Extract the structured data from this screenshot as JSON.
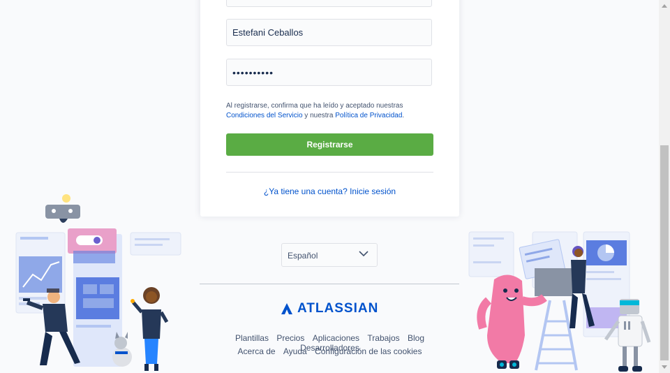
{
  "form": {
    "name_value": "Estefani Ceballos",
    "password_value": "••••••••••",
    "terms_prefix": "Al registrarse, confirma que ha leído y aceptado nuestras",
    "terms_link": "Condiciones del Servicio",
    "terms_middle": " y nuestra ",
    "privacy_link": "Política de Privacidad",
    "terms_suffix": ".",
    "register_label": "Registrarse",
    "login_link": "¿Ya tiene una cuenta? Inicie sesión"
  },
  "language": {
    "selected": "Español"
  },
  "footer": {
    "brand": "ATLASSIAN",
    "links_row1": [
      "Plantillas",
      "Precios",
      "Aplicaciones",
      "Trabajos",
      "Blog",
      "Desarrolladores"
    ],
    "links_row2": [
      "Acerca de",
      "Ayuda",
      "Configuración de las cookies"
    ]
  },
  "colors": {
    "accent": "#5aac44",
    "link": "#0052cc",
    "brand": "#0052cc"
  }
}
